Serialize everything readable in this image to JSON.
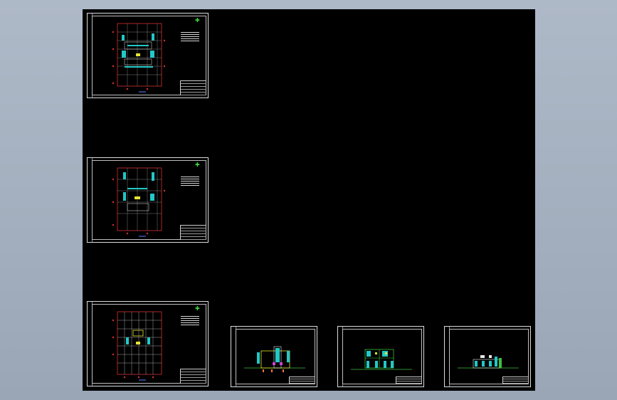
{
  "viewport": {
    "background": "#9fabba"
  },
  "model_space": {
    "background": "#000000"
  },
  "colors": {
    "frame": "#dcdcdc",
    "column_axis": "#d83030",
    "walls": "#22c8c8",
    "accent_yellow": "#e6e630",
    "north_arrow": "#3fdc3f",
    "ground_line": "#3fbf3f",
    "magenta": "#d040d0",
    "blue_dim": "#6080ff"
  },
  "icons": {
    "north_arrow": "north-arrow-icon"
  },
  "sheets": [
    {
      "id": "plan-1",
      "kind": "floor-plan"
    },
    {
      "id": "plan-2",
      "kind": "floor-plan"
    },
    {
      "id": "plan-3",
      "kind": "floor-plan"
    },
    {
      "id": "elevation-1",
      "kind": "elevation"
    },
    {
      "id": "elevation-2",
      "kind": "elevation"
    },
    {
      "id": "elevation-3",
      "kind": "elevation"
    }
  ]
}
